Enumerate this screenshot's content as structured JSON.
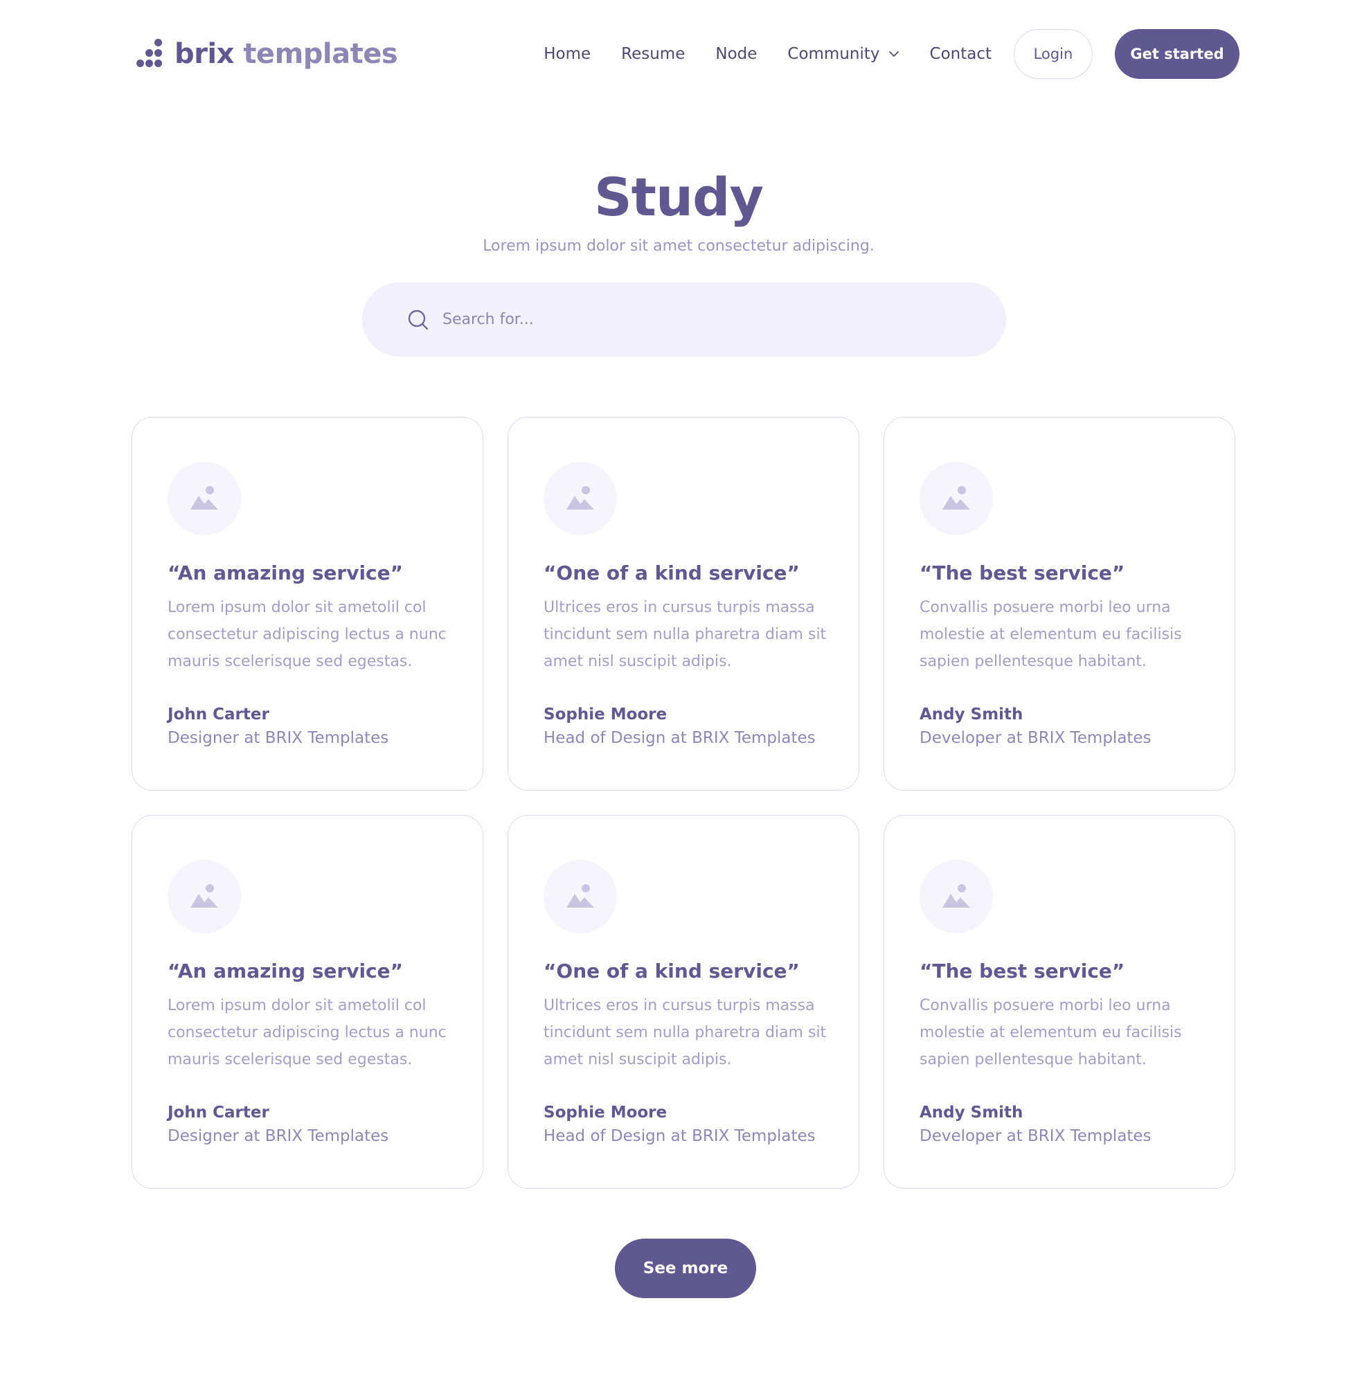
{
  "colors": {
    "brand": "#5f5891",
    "search_bg": "#f1f0fb",
    "muted_text": "#a39ec5"
  },
  "logo": {
    "word1": "brix",
    "word2": "templates"
  },
  "nav": {
    "items": [
      "Home",
      "Resume",
      "Node",
      "Community",
      "Contact"
    ],
    "login_label": "Login",
    "cta_label": "Get started"
  },
  "hero": {
    "title": "Study",
    "subtitle": "Lorem ipsum dolor sit amet consectetur adipiscing."
  },
  "search": {
    "placeholder": "Search for...",
    "value": ""
  },
  "cards": [
    {
      "title": "“An amazing service”",
      "body": "Lorem ipsum dolor sit ametolil col consectetur adipiscing lectus a nunc mauris scelerisque sed egestas.",
      "name": "John Carter",
      "role": "Designer at BRIX Templates"
    },
    {
      "title": "“One of a kind service”",
      "body": "Ultrices eros in cursus turpis massa tincidunt sem nulla pharetra diam sit amet nisl suscipit adipis.",
      "name": "Sophie Moore",
      "role": "Head of Design at BRIX Templates"
    },
    {
      "title": "“The best service”",
      "body": "Convallis posuere morbi leo urna molestie at elementum eu facilisis sapien pellentesque habitant.",
      "name": "Andy Smith",
      "role": "Developer at BRIX Templates"
    },
    {
      "title": "“An amazing service”",
      "body": "Lorem ipsum dolor sit ametolil col consectetur adipiscing lectus a nunc mauris scelerisque sed egestas.",
      "name": "John Carter",
      "role": "Designer at BRIX Templates"
    },
    {
      "title": "“One of a kind service”",
      "body": "Ultrices eros in cursus turpis massa tincidunt sem nulla pharetra diam sit amet nisl suscipit adipis.",
      "name": "Sophie Moore",
      "role": "Head of Design at BRIX Templates"
    },
    {
      "title": "“The best service”",
      "body": "Convallis posuere morbi leo urna molestie at elementum eu facilisis sapien pellentesque habitant.",
      "name": "Andy Smith",
      "role": "Developer at BRIX Templates"
    }
  ],
  "see_more_label": "See more"
}
